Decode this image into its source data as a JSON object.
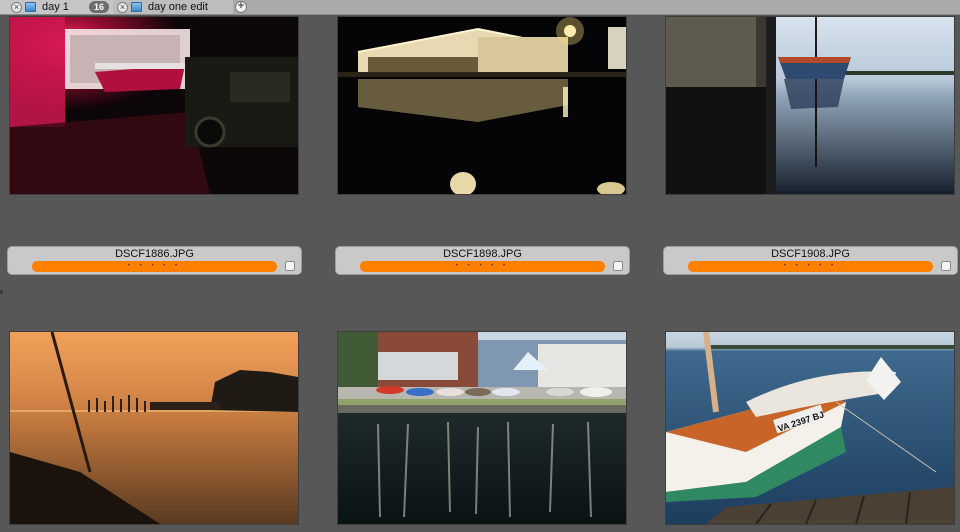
{
  "tabs": [
    {
      "label": "day 1",
      "count": "16",
      "close_icon": "close-icon",
      "folder_icon": "folder-icon"
    },
    {
      "label": "day one edit",
      "close_icon": "close-icon",
      "folder_icon": "folder-icon"
    }
  ],
  "add_tab_icon": "plus-icon",
  "accent": "#ff7f00",
  "glyphs": {
    "close": "×",
    "add": "+"
  },
  "photos": [
    {
      "filename": "DSCF1886.JPG",
      "rating": "• • • • •",
      "scene": "red-lit boat trailer at night"
    },
    {
      "filename": "DSCF1898.JPG",
      "rating": "• • • • •",
      "scene": "boathouse reflected at night"
    },
    {
      "filename": "DSCF1908.JPG",
      "rating": "• • • • •",
      "scene": "sailboat by dock at dusk"
    },
    {
      "filename": "",
      "rating": "",
      "scene": "sunset over water from boat"
    },
    {
      "filename": "",
      "rating": "",
      "scene": "sailing dinghies at marina"
    },
    {
      "filename": "",
      "rating": "",
      "scene": "sailboat VA 2397 BJ at dock"
    }
  ],
  "photo6_registration": "VA 2397 BJ"
}
